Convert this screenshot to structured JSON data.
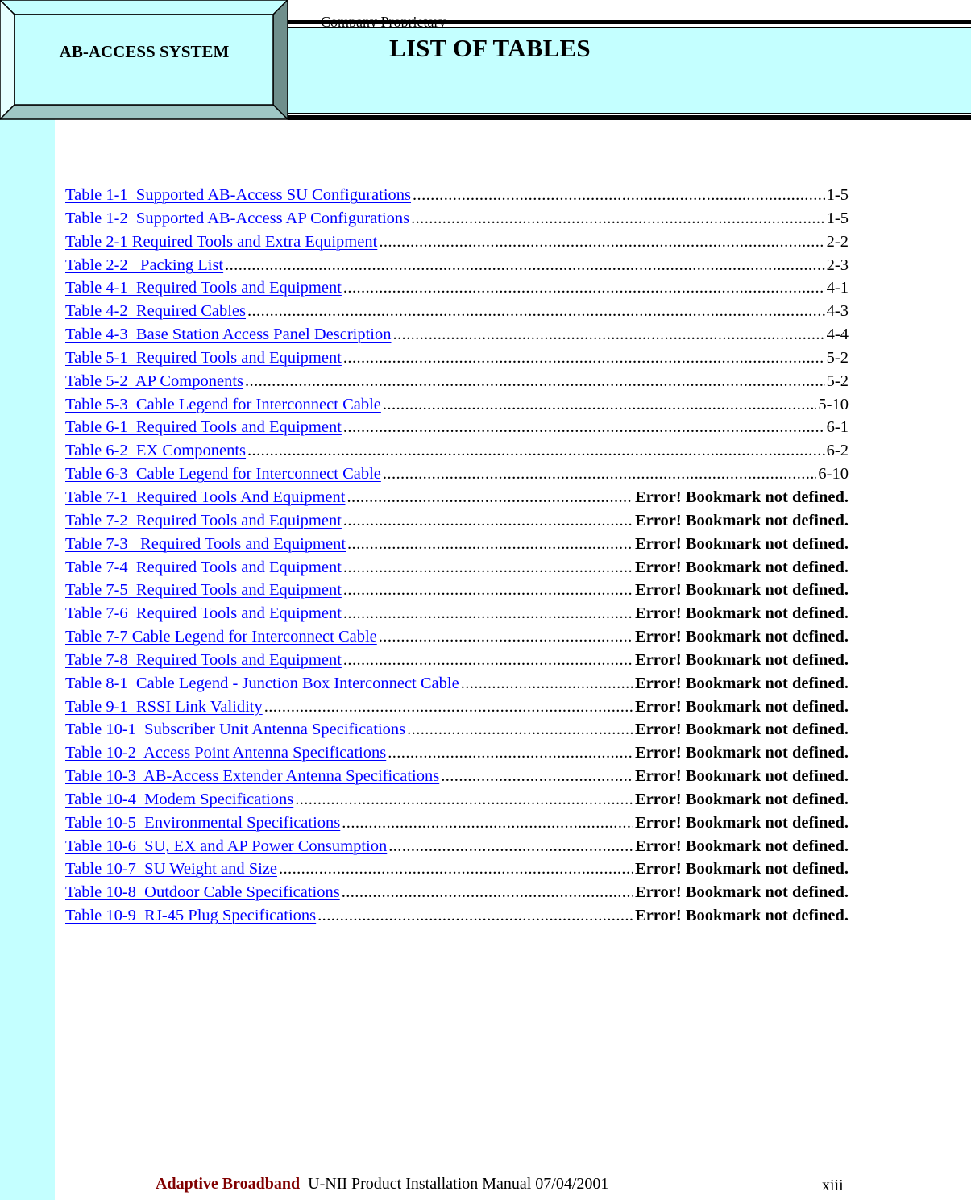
{
  "header": {
    "system_label": "AB-ACCESS SYSTEM",
    "page_title": "LIST OF TABLES",
    "watermark": "Company Proprietary"
  },
  "colors": {
    "band_fill": "#c4ffff",
    "link": "#0000ff",
    "brand": "#800000",
    "bevel_top": "#c4ffff",
    "bevel_left": "#e6ffff",
    "bevel_right": "#6f8f8c",
    "bevel_bottom": "#9fc7c5"
  },
  "toc": {
    "entries": [
      {
        "label": "Table 1-1  Supported AB-Access SU Configurations",
        "page": "1-5",
        "error": false
      },
      {
        "label": "Table 1-2  Supported AB-Access AP Configurations",
        "page": "1-5",
        "error": false
      },
      {
        "label": "Table 2-1 Required Tools and Extra Equipment",
        "page": "2-2",
        "error": false
      },
      {
        "label": "Table 2-2   Packing List",
        "page": "2-3",
        "error": false
      },
      {
        "label": "Table 4-1  Required Tools and Equipment",
        "page": "4-1",
        "error": false
      },
      {
        "label": "Table 4-2  Required Cables",
        "page": "4-3",
        "error": false
      },
      {
        "label": "Table 4-3  Base Station Access Panel Description",
        "page": "4-4",
        "error": false
      },
      {
        "label": "Table 5-1  Required Tools and Equipment",
        "page": "5-2",
        "error": false
      },
      {
        "label": "Table 5-2  AP Components",
        "page": "5-2",
        "error": false
      },
      {
        "label": "Table 5-3  Cable Legend for Interconnect Cable",
        "page": "5-10",
        "error": false
      },
      {
        "label": "Table 6-1  Required Tools and Equipment",
        "page": "6-1",
        "error": false
      },
      {
        "label": "Table 6-2  EX Components",
        "page": "6-2",
        "error": false
      },
      {
        "label": "Table 6-3  Cable Legend for Interconnect Cable",
        "page": "6-10",
        "error": false
      },
      {
        "label": "Table 7-1  Required Tools And Equipment",
        "page": "Error! Bookmark not defined.",
        "error": true
      },
      {
        "label": "Table 7-2  Required Tools and Equipment",
        "page": "Error! Bookmark not defined.",
        "error": true
      },
      {
        "label": "Table 7-3   Required Tools and Equipment",
        "page": "Error! Bookmark not defined.",
        "error": true
      },
      {
        "label": "Table 7-4  Required Tools and Equipment",
        "page": "Error! Bookmark not defined.",
        "error": true
      },
      {
        "label": "Table 7-5  Required Tools and Equipment",
        "page": "Error! Bookmark not defined.",
        "error": true
      },
      {
        "label": "Table 7-6  Required Tools and Equipment",
        "page": "Error! Bookmark not defined.",
        "error": true
      },
      {
        "label": "Table 7-7 Cable Legend for Interconnect Cable",
        "page": "Error! Bookmark not defined.",
        "error": true
      },
      {
        "label": "Table 7-8  Required Tools and Equipment",
        "page": "Error! Bookmark not defined.",
        "error": true
      },
      {
        "label": "Table 8-1  Cable Legend - Junction Box Interconnect Cable",
        "page": "Error! Bookmark not defined.",
        "error": true
      },
      {
        "label": "Table 9-1  RSSI Link Validity",
        "page": "Error! Bookmark not defined.",
        "error": true
      },
      {
        "label": "Table 10-1  Subscriber Unit Antenna Specifications",
        "page": "Error! Bookmark not defined.",
        "error": true
      },
      {
        "label": "Table 10-2  Access Point Antenna Specifications",
        "page": "Error! Bookmark not defined.",
        "error": true
      },
      {
        "label": "Table 10-3  AB-Access Extender Antenna Specifications",
        "page": "Error! Bookmark not defined.",
        "error": true
      },
      {
        "label": "Table 10-4  Modem Specifications",
        "page": "Error! Bookmark not defined.",
        "error": true
      },
      {
        "label": "Table 10-5  Environmental Specifications",
        "page": "Error! Bookmark not defined.",
        "error": true
      },
      {
        "label": "Table 10-6  SU, EX and AP Power Consumption",
        "page": "Error! Bookmark not defined.",
        "error": true
      },
      {
        "label": "Table 10-7  SU Weight and Size",
        "page": "Error! Bookmark not defined.",
        "error": true
      },
      {
        "label": "Table 10-8  Outdoor Cable Specifications",
        "page": "Error! Bookmark not defined.",
        "error": true
      },
      {
        "label": "Table 10-9  RJ-45 Plug Specifications",
        "page": "Error! Bookmark not defined.",
        "error": true
      }
    ]
  },
  "footer": {
    "brand": "Adaptive Broadband",
    "document": "U-NII Product Installation Manual  07/04/2001",
    "page_number": "xiii"
  }
}
